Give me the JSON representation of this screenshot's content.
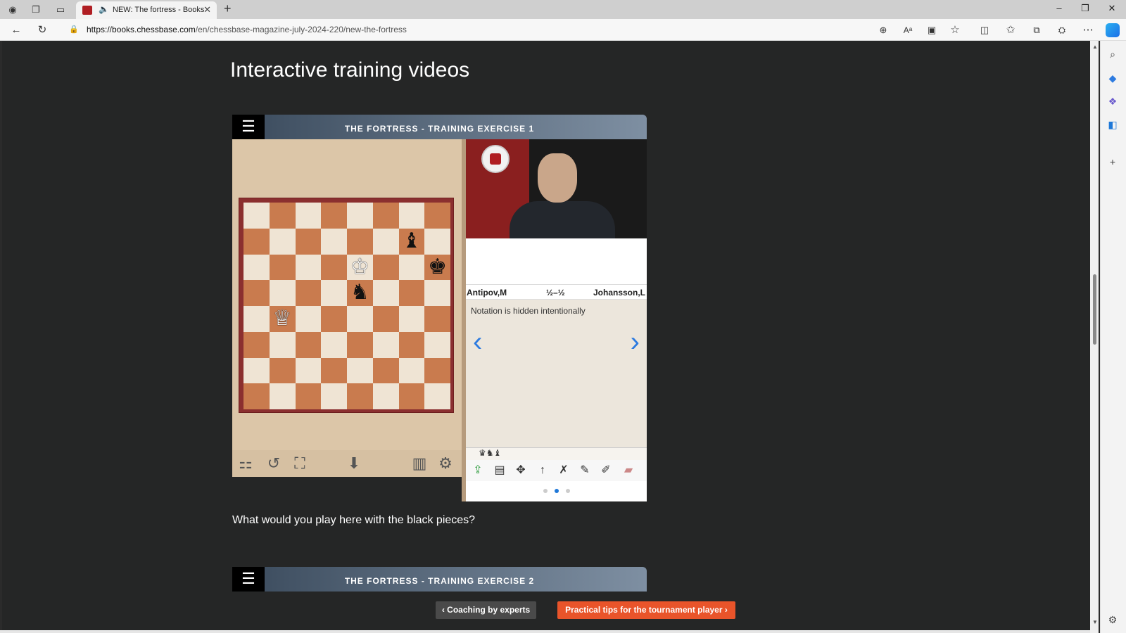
{
  "browser": {
    "tab_title": "NEW: The fortress - Books",
    "url_host": "https://books.chessbase.com",
    "url_path": "/en/chessbase-magazine-july-2024-220/new-the-fortress"
  },
  "page": {
    "heading": "Interactive training videos",
    "question": "What would you play here with the black pieces?"
  },
  "widget1": {
    "title": "THE FORTRESS - TRAINING EXERCISE 1",
    "white_player": "Antipov,M",
    "result": "½–½",
    "black_player": "Johansson,L",
    "notation_text": "Notation is hidden intentionally",
    "board": [
      [
        "",
        "",
        "",
        "",
        "",
        "",
        "",
        ""
      ],
      [
        "",
        "",
        "",
        "",
        "",
        "",
        "♝",
        ""
      ],
      [
        "",
        "",
        "",
        "",
        "♔",
        "",
        "",
        "♚"
      ],
      [
        "",
        "",
        "",
        "",
        "♞",
        "",
        "",
        ""
      ],
      [
        "",
        "♕",
        "",
        "",
        "",
        "",
        "",
        ""
      ],
      [
        "",
        "",
        "",
        "",
        "",
        "",
        "",
        ""
      ],
      [
        "",
        "",
        "",
        "",
        "",
        "",
        "",
        ""
      ],
      [
        "",
        "",
        "",
        "",
        "",
        "",
        "",
        ""
      ]
    ],
    "mini_pieces": "♛♞♝",
    "pages": 3,
    "active_page": 2
  },
  "widget2": {
    "title": "THE FORTRESS - TRAINING EXERCISE 2"
  },
  "pager": {
    "prev": "Coaching by experts",
    "next": "Practical tips for the tournament player"
  },
  "icons": {
    "menu": "hamburger-icon",
    "prev_move": "chevron-left-icon",
    "next_move": "chevron-right-icon"
  }
}
